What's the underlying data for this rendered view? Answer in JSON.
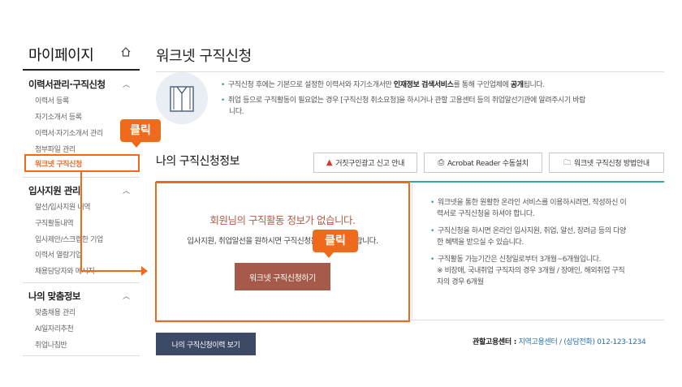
{
  "sidebar": {
    "title": "마이페이지",
    "sections": [
      {
        "title": "이력서관리·구직신청",
        "items": [
          "이력서 등록",
          "자기소개서 등록",
          "이력서·자기소개서 관리",
          "첨부파일 관리",
          "워크넷 구직신청"
        ]
      },
      {
        "title": "입사지원 관리",
        "items": [
          "알선/입사지원 내역",
          "구직활동내역",
          "입사제안/스크랩한 기업",
          "이력서 열람기업",
          "채용담당자와 메시지"
        ]
      },
      {
        "title": "나의 맞춤정보",
        "items": [
          "맞춤채용 관리",
          "AI일자리추천",
          "취업나침반"
        ]
      }
    ]
  },
  "callouts": {
    "first": "클릭",
    "second": "클릭"
  },
  "main": {
    "title": "워크넷 구직신청",
    "info": {
      "line1_a": "구직신청 후에는 기본으로 설정한 이력서와 자기소개서만 ",
      "line1_b": "인재정보 검색서비스",
      "line1_c": "를 통해 구인업체에 ",
      "line1_d": "공개",
      "line1_e": "됩니다.",
      "line2": "취업 등으로 구직활동이 필요없는 경우 [구직신청 취소요청]을 하시거나 관할 고용센터 등의 취업알선기관에 알려주시기 바랍",
      "line2b": "니다."
    },
    "section_title": "나의 구직신청정보",
    "buttons": {
      "fake_ad": "거짓구인광고 신고 안내",
      "acrobat": "Acrobat Reader 수동설치",
      "howto": "워크넷 구직신청 방법안내"
    },
    "panel": {
      "no_info": "회원님의 구직활동 정보가 없습니다.",
      "no_info_sub": "입사지원, 취업알선을 원하시면 구직신청을 해주시기 바랍니다.",
      "apply_button": "워크넷 구직신청하기",
      "right_lines": [
        [
          "워크넷을 통한 원활한 온라인 서비스를 이용하시려면, 작성하신 이",
          "력서로 구직신청을 하셔야 합니다."
        ],
        [
          "구직신청을 하시면 온라인 입사지원, 취업, 알선, 장려금 등의 다양",
          "한 혜택을 받으실 수 있습니다."
        ],
        [
          "구직활동 가능기간은 신청일로부터 3개월~6개월입니다.",
          "※ 비장애, 국내취업 구직자의 경우 3개월 / 장애인, 해외취업 구직",
          "자의 경우 6개월"
        ]
      ]
    },
    "history_button": "나의 구직신청이력 보기",
    "center": {
      "label": "관할고용센터 :",
      "center_name": "지역고용센터",
      "sep": "/",
      "phone_label": "(상담전화)",
      "phone": "012-123-1234"
    }
  }
}
